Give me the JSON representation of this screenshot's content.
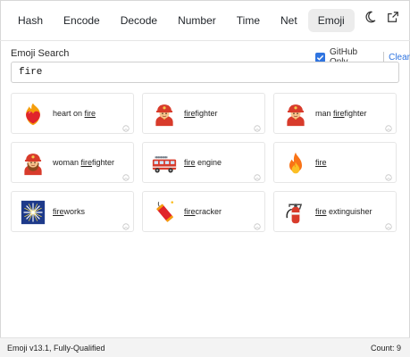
{
  "nav": {
    "tabs": [
      {
        "label": "Hash",
        "active": false
      },
      {
        "label": "Encode",
        "active": false
      },
      {
        "label": "Decode",
        "active": false
      },
      {
        "label": "Number",
        "active": false
      },
      {
        "label": "Time",
        "active": false
      },
      {
        "label": "Net",
        "active": false
      },
      {
        "label": "Emoji",
        "active": true
      }
    ],
    "icons": [
      "moon-icon",
      "external-link-icon"
    ]
  },
  "search": {
    "title": "Emoji Search",
    "github_only_label": "GitHub Only",
    "github_only_checked": true,
    "clear_label": "Clear",
    "query": "fire"
  },
  "results": [
    {
      "emoji": "heart-on-fire",
      "pre": "heart on ",
      "match": "fire",
      "post": ""
    },
    {
      "emoji": "firefighter",
      "pre": "",
      "match": "fire",
      "post": "fighter"
    },
    {
      "emoji": "man-firefighter",
      "pre": "man ",
      "match": "fire",
      "post": "fighter"
    },
    {
      "emoji": "woman-firefighter",
      "pre": "woman ",
      "match": "fire",
      "post": "fighter"
    },
    {
      "emoji": "fire-engine",
      "pre": "",
      "match": "fire",
      "post": " engine"
    },
    {
      "emoji": "fire",
      "pre": "",
      "match": "fire",
      "post": ""
    },
    {
      "emoji": "fireworks",
      "pre": "",
      "match": "fire",
      "post": "works"
    },
    {
      "emoji": "firecracker",
      "pre": "",
      "match": "fire",
      "post": "cracker"
    },
    {
      "emoji": "fire-extinguisher",
      "pre": "",
      "match": "fire",
      "post": " extinguisher"
    }
  ],
  "status": {
    "version": "Emoji v13.1, Fully-Qualified",
    "count": "Count: 9"
  },
  "colors": {
    "accent": "#2f74e0",
    "active_tab_bg": "#ececec",
    "status_bg": "#f3f3f3"
  }
}
